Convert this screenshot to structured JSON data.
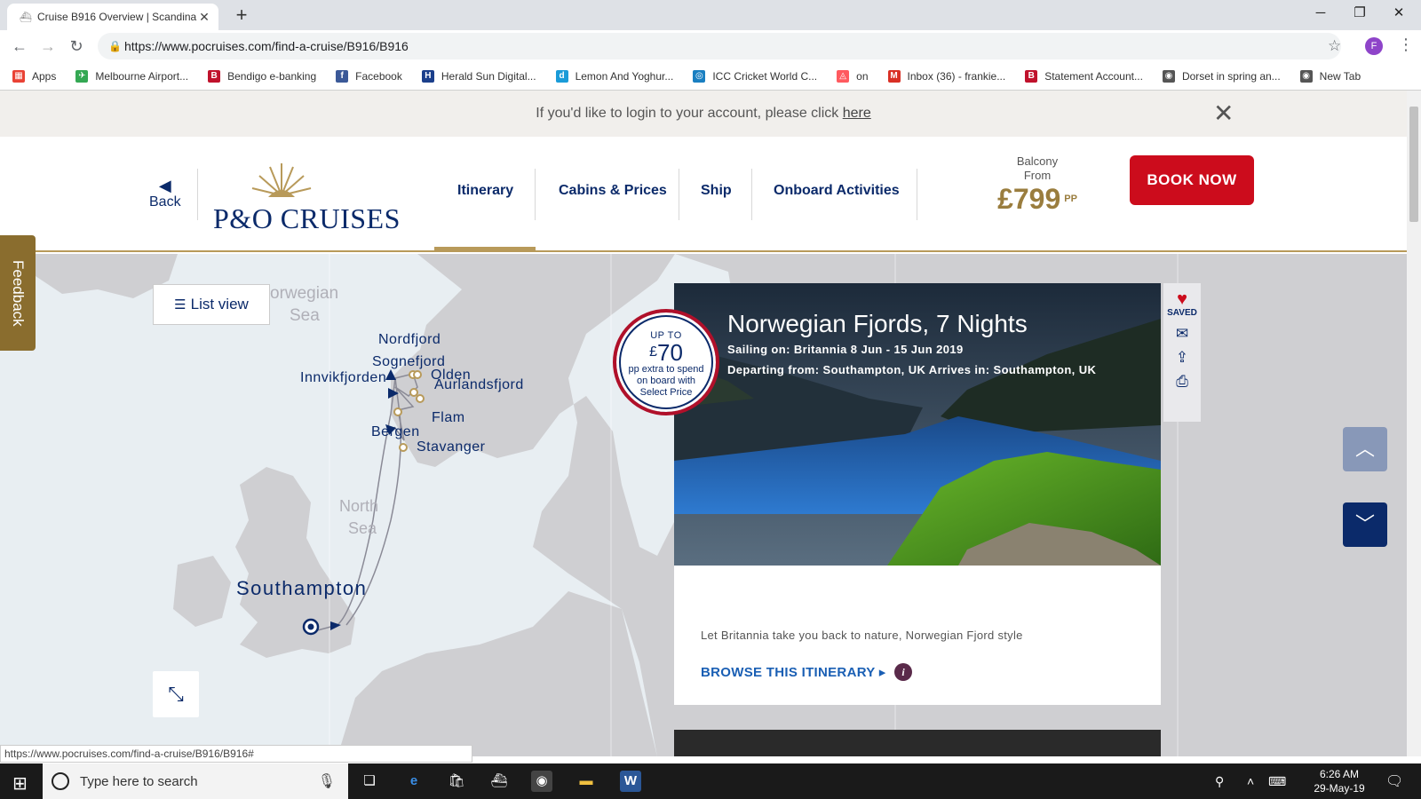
{
  "browser": {
    "tab_title": "Cruise B916 Overview | Scandina",
    "url": "https://www.pocruises.com/find-a-cruise/B916/B916",
    "profile_initial": "F",
    "bookmarks": [
      {
        "label": "Apps",
        "color": "#e94235",
        "glyph": "▦"
      },
      {
        "label": "Melbourne Airport...",
        "color": "#34a853",
        "glyph": "✈"
      },
      {
        "label": "Bendigo e-banking",
        "color": "#c0122c",
        "glyph": "B"
      },
      {
        "label": "Facebook",
        "color": "#3b5998",
        "glyph": "f"
      },
      {
        "label": "Herald Sun Digital...",
        "color": "#1b3f8b",
        "glyph": "H"
      },
      {
        "label": "Lemon And Yoghur...",
        "color": "#1a9bd8",
        "glyph": "d"
      },
      {
        "label": "ICC Cricket World C...",
        "color": "#1a7fc1",
        "glyph": "◎"
      },
      {
        "label": "on",
        "color": "#ff5a5f",
        "glyph": "◬"
      },
      {
        "label": "Inbox (36) - frankie...",
        "color": "#d93025",
        "glyph": "M"
      },
      {
        "label": "Statement Account...",
        "color": "#c0122c",
        "glyph": "B"
      },
      {
        "label": "Dorset in spring an...",
        "color": "#555555",
        "glyph": "◉"
      },
      {
        "label": "New Tab",
        "color": "#555555",
        "glyph": "◉"
      }
    ]
  },
  "notice": {
    "text": "If you'd like to login to your account, please click ",
    "link": "here"
  },
  "header": {
    "back_label": "Back",
    "logo_text": "P&O CRUISES",
    "nav": [
      "Itinerary",
      "Cabins & Prices",
      "Ship",
      "Onboard Activities"
    ],
    "price_label1": "Balcony",
    "price_label2": "From",
    "price_amount": "£799",
    "price_unit": "PP",
    "book_label": "BOOK NOW"
  },
  "map": {
    "feedback_label": "Feedback",
    "list_view_label": "List view",
    "sea_labels": [
      "orwegian",
      "Sea",
      "North",
      "Sea"
    ],
    "ports": [
      "Nordfjord",
      "Sognefjord",
      "Olden",
      "Innvikfjorden",
      "Aurlandsfjord",
      "Flam",
      "Bergen",
      "Stavanger",
      "Southampton"
    ]
  },
  "card": {
    "title": "Norwegian Fjords, 7 Nights",
    "sailing": "Sailing on: Britannia  8 Jun - 15 Jun 2019",
    "departing": "Departing from: Southampton, UK  Arrives in: Southampton, UK",
    "badge_top": "UP TO",
    "badge_currency": "£",
    "badge_amount": "70",
    "badge_text": "pp extra to spend on board with Select Price",
    "description": "Let Britannia take you back to nature, Norwegian Fjord style",
    "browse_label": "BROWSE THIS ITINERARY",
    "saved_label": "SAVED"
  },
  "status_url": "https://www.pocruises.com/find-a-cruise/B916/B916#",
  "taskbar": {
    "search_placeholder": "Type here to search",
    "time": "6:26 AM",
    "date": "29-May-19"
  }
}
